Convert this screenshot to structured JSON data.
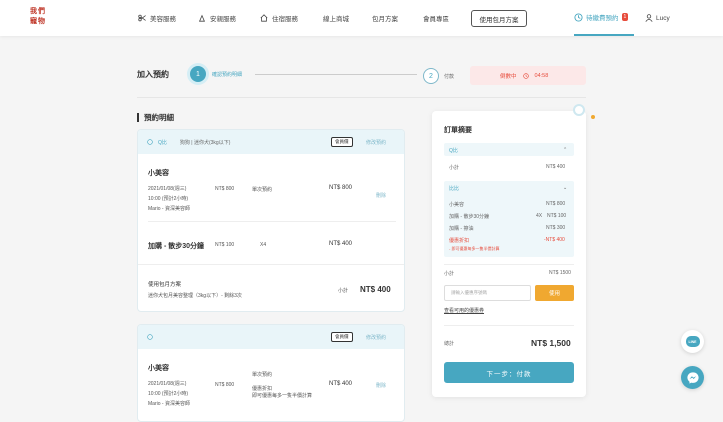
{
  "brand": {
    "logo_line1": "我們",
    "logo_line2": "寵物"
  },
  "nav": {
    "items": [
      "美容服務",
      "安親服務",
      "住宿服務",
      "線上商城",
      "包月方案",
      "會員專區"
    ],
    "cta": "使用包月方案",
    "waiting": "待繳費預約",
    "waiting_count": "1",
    "user": "Lucy"
  },
  "steps": {
    "title": "加入預約",
    "step1_num": "1",
    "step1_label": "確認預約明細",
    "step2_num": "2",
    "step2_label": "付款",
    "countdown_label": "倒數中",
    "countdown_time": "04:58"
  },
  "section_title": "預約明細",
  "card1": {
    "pet": "Q比",
    "pet_info": "狗狗 | 迷你犬(3kg以下)",
    "tag": "會員價",
    "modify": "修改預約",
    "service": "小美容",
    "date": "2021/01/08(週三)",
    "time": "10:00 (預計2小時)",
    "staff": "Mario - 資深美容師",
    "unit_price": "NT$ 800",
    "type": "單次預約",
    "price": "NT$ 800",
    "del": "刪除",
    "addon": "加購 - 散步30分鐘",
    "addon_unit": "NT$ 100",
    "addon_qty": "X4",
    "addon_price": "NT$ 400",
    "plan": "使用包月方案",
    "plan_desc": "迷你犬包月美容整理（3kg以下）- 剩餘3次",
    "subtotal_label": "小計",
    "subtotal": "NT$ 400"
  },
  "card2": {
    "tag": "會員價",
    "modify": "修改預約",
    "service": "小美容",
    "date": "2021/01/08(週三)",
    "time": "10:00 (預計2小時)",
    "staff": "Mario - 資深美容師",
    "unit_price": "NT$ 800",
    "type": "單次預約",
    "discount": "優惠折扣",
    "discount_desc": "即可優惠每多一隻半價計算",
    "price": "NT$ 400",
    "del": "刪除"
  },
  "summary": {
    "title": "訂單摘要",
    "p1_name": "Q比",
    "p1_sub_label": "小計",
    "p1_sub": "NT$ 400",
    "p2_name": "比比",
    "l1": "小美容",
    "v1": "NT$ 800",
    "l2": "加購 - 散步30分鐘",
    "q2": "4X",
    "v2": "NT$ 100",
    "l3": "加購 - 擦油",
    "v3": "NT$ 300",
    "l4": "優惠折扣",
    "v4": "-NT$ 400",
    "l4_desc": "- 即可優惠每多一隻半價計算",
    "sub_label": "小計",
    "sub": "NT$ 1500",
    "coupon_placeholder": "請輸入優惠序號碼",
    "coupon_btn": "使用",
    "coupon_link": "查看可用的優惠券",
    "total_label": "總計",
    "total": "NT$ 1,500",
    "next": "下一步：付款"
  },
  "fab": {
    "line": "LINE"
  }
}
